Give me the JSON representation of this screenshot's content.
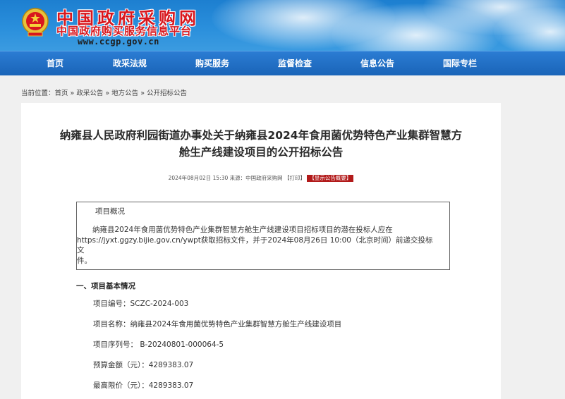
{
  "header": {
    "site_title": "中国政府采购网",
    "site_subtitle": "中国政府购买服务信息平台",
    "site_url": "www.ccgp.gov.cn"
  },
  "nav": {
    "items": [
      {
        "label": "首页"
      },
      {
        "label": "政采法规"
      },
      {
        "label": "购买服务"
      },
      {
        "label": "监督检查"
      },
      {
        "label": "信息公告"
      },
      {
        "label": "国际专栏"
      }
    ]
  },
  "breadcrumb": {
    "prefix": "当前位置：",
    "items": [
      "首页",
      "政采公告",
      "地方公告",
      "公开招标公告"
    ],
    "separator": "»"
  },
  "article": {
    "title_line1": "纳雍县人民政府利园街道办事处关于纳雍县2024年食用菌优势特色产业集群智慧方",
    "title_line2": "舱生产线建设项目的公开招标公告",
    "meta": "2024年08月02日 15:30 来源：中国政府采购网",
    "print_label": "【打印】",
    "summary_label": "【显示公告概要】",
    "overview": {
      "title": "项目概况",
      "line1": "纳雍县2024年食用菌优势特色产业集群智慧方舱生产线建设项目招标项目的潜在投标人应在",
      "line2": "https://jyxt.ggzy.bijie.gov.cn/ywpt获取招标文件，并于2024年08月26日 10:00（北京时间）前递交投标文",
      "line3": "件。"
    },
    "section1": {
      "heading": "一、项目基本情况",
      "fields": [
        "项目编号：SCZC-2024-003",
        "项目名称：纳雍县2024年食用菌优势特色产业集群智慧方舱生产线建设项目",
        "项目序列号： B-20240801-000064-5",
        "预算金额（元）：4289383.07",
        "最高限价（元）：4289383.07"
      ]
    }
  },
  "colors": {
    "brand_red": "#d8171e",
    "nav_blue": "#1a64b8",
    "summary_red": "#b21a1a"
  }
}
